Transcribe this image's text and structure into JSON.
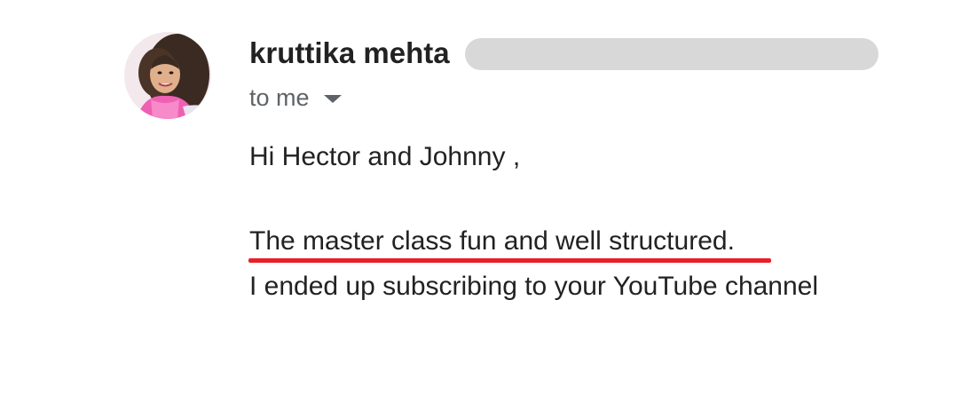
{
  "sender": {
    "name": "kruttika mehta"
  },
  "recipient": {
    "label": "to me"
  },
  "message": {
    "greeting": "Hi Hector and Johnny ,",
    "lines": [
      "The master class fun and well structured.",
      "I ended up subscribing to your YouTube channel"
    ]
  },
  "icons": {
    "recipient_caret": "caret-down-icon"
  },
  "colors": {
    "highlight_underline": "#e8202a",
    "redaction": "#d8d8d8",
    "secondary_text": "#5f6368"
  }
}
